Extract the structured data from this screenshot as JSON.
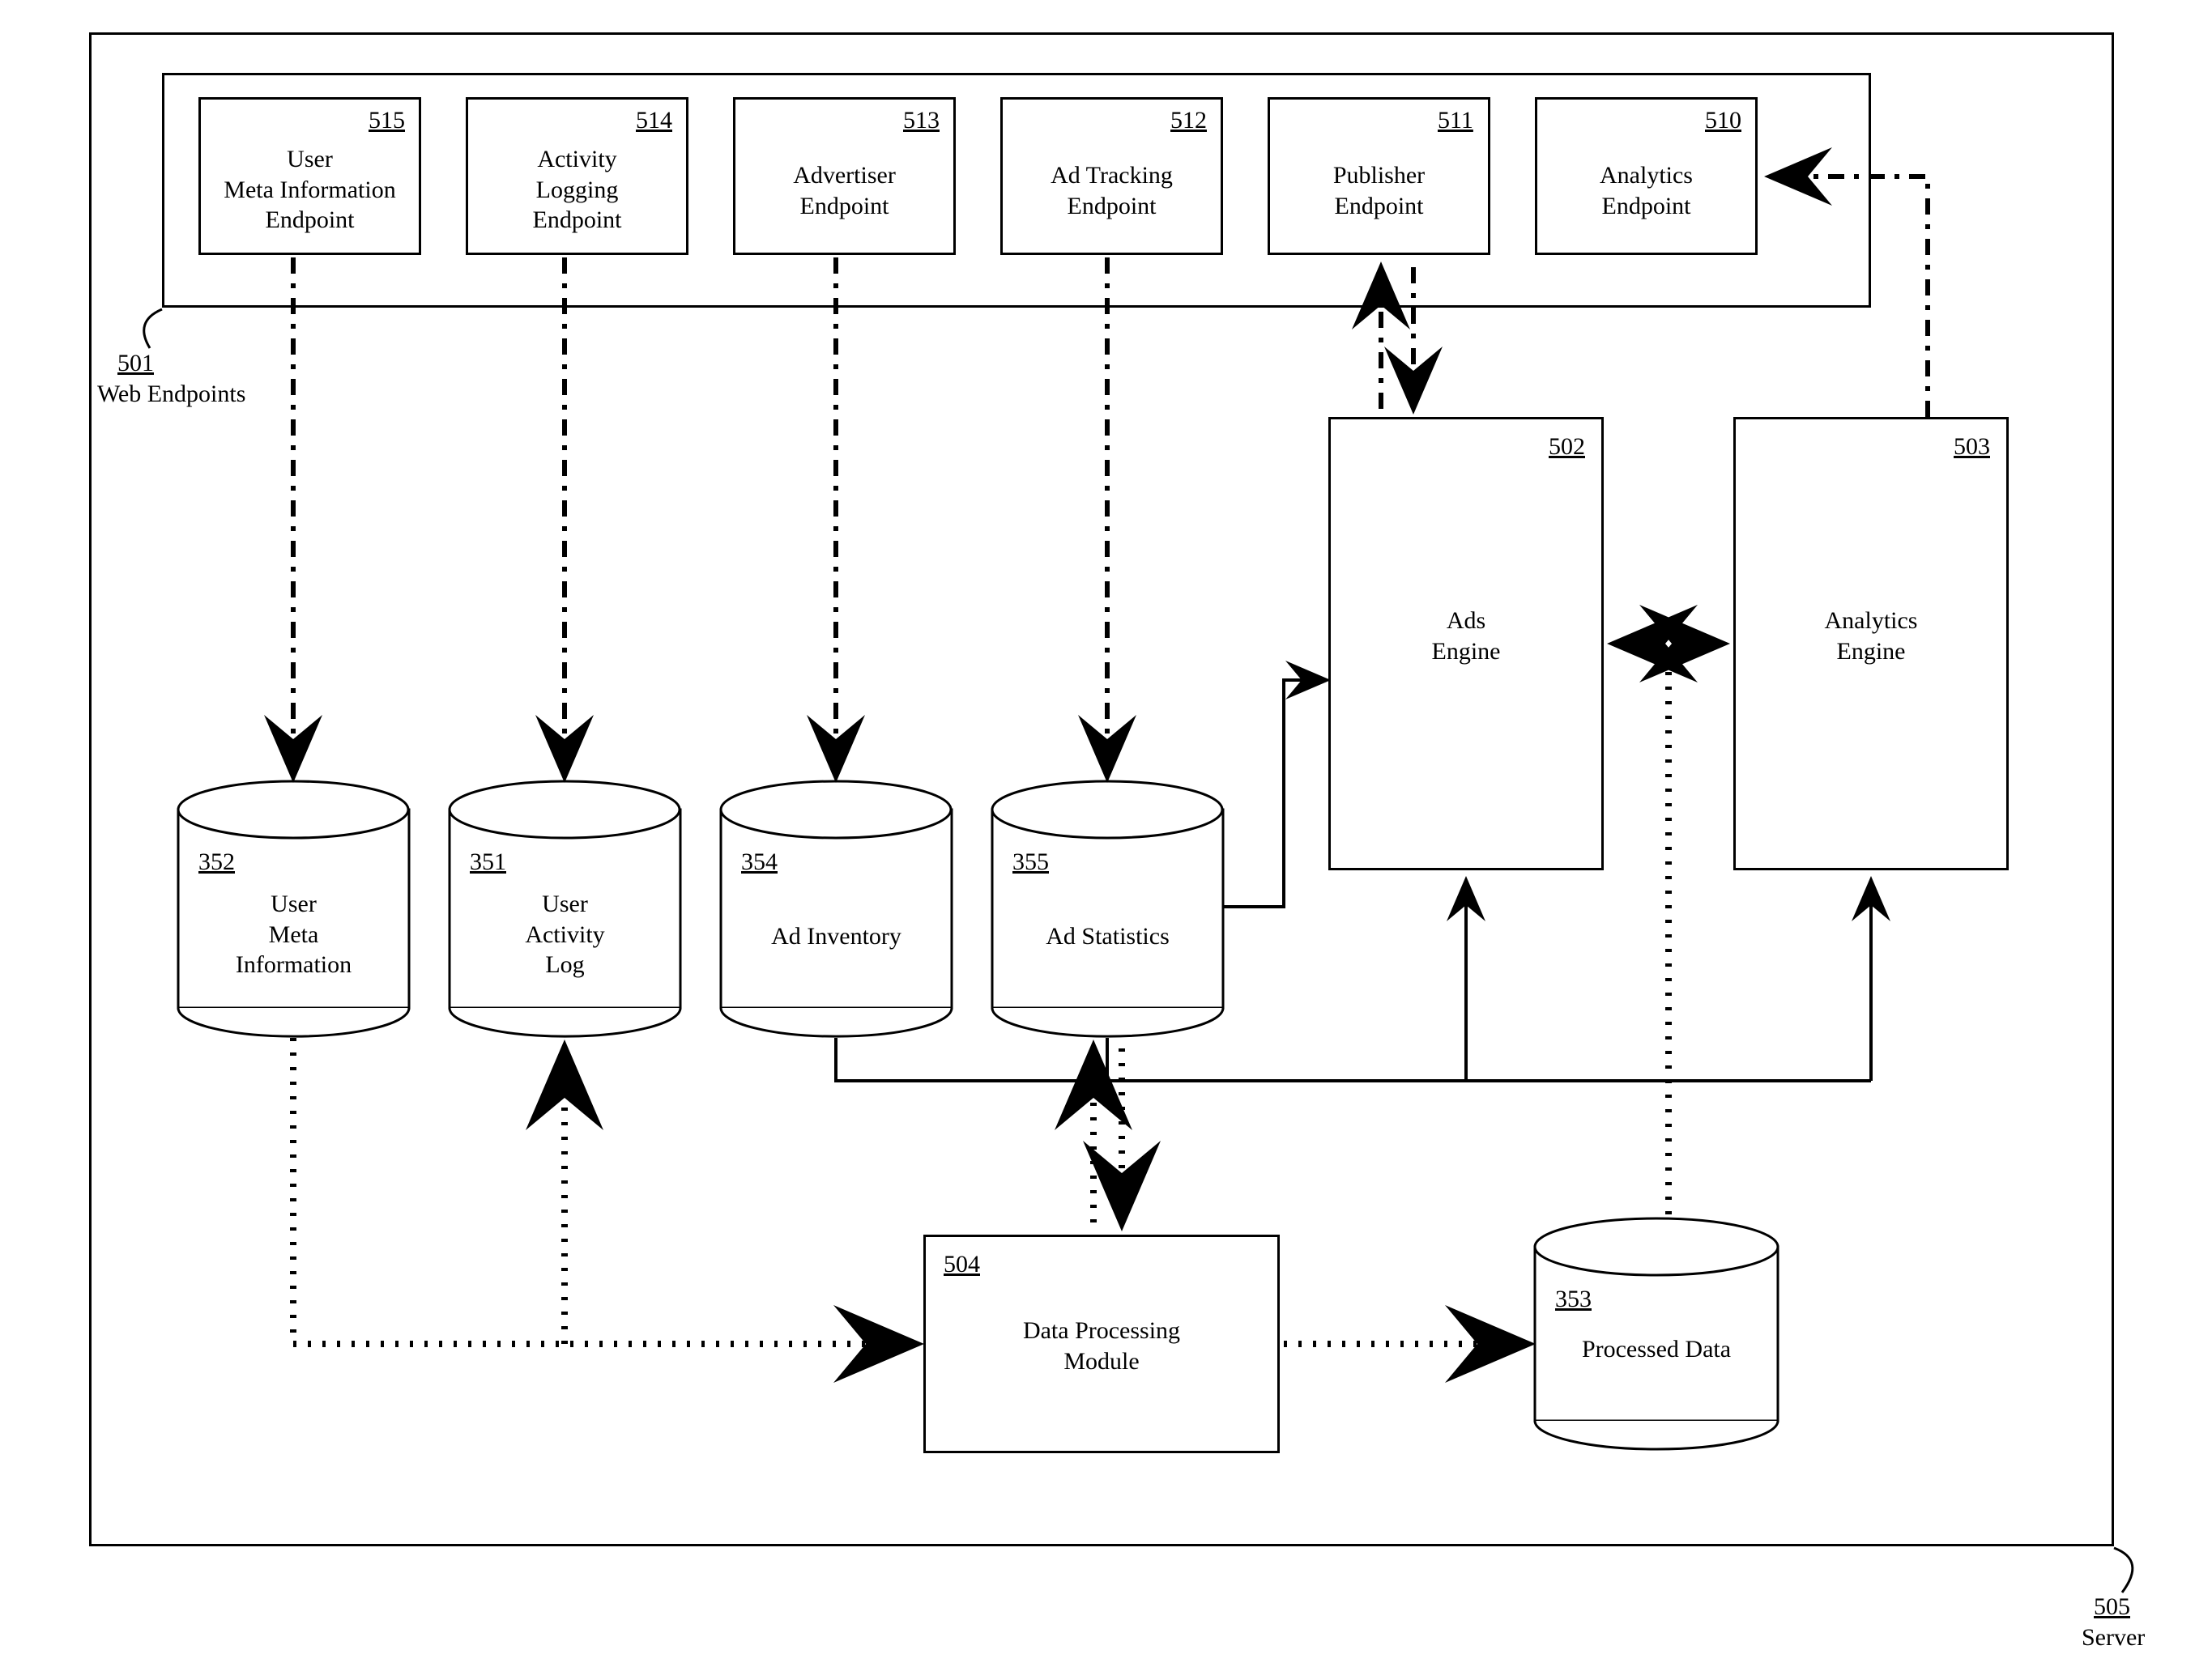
{
  "outer": {
    "callout_ref": "505",
    "callout_label": "Server"
  },
  "endpoints_container": {
    "callout_ref": "501",
    "callout_label": "Web Endpoints"
  },
  "endpoints": {
    "e510": {
      "ref": "510",
      "label": "Analytics\nEndpoint"
    },
    "e511": {
      "ref": "511",
      "label": "Publisher\nEndpoint"
    },
    "e512": {
      "ref": "512",
      "label": "Ad Tracking\nEndpoint"
    },
    "e513": {
      "ref": "513",
      "label": "Advertiser\nEndpoint"
    },
    "e514": {
      "ref": "514",
      "label": "Activity\nLogging\nEndpoint"
    },
    "e515": {
      "ref": "515",
      "label": "User\nMeta Information\nEndpoint"
    }
  },
  "engines": {
    "ads": {
      "ref": "502",
      "label": "Ads\nEngine"
    },
    "analytics": {
      "ref": "503",
      "label": "Analytics\nEngine"
    }
  },
  "dpm": {
    "ref": "504",
    "label": "Data Processing\nModule"
  },
  "cylinders": {
    "c352": {
      "ref": "352",
      "label": "User\nMeta\nInformation"
    },
    "c351": {
      "ref": "351",
      "label": "User\nActivity\nLog"
    },
    "c354": {
      "ref": "354",
      "label": "Ad Inventory"
    },
    "c355": {
      "ref": "355",
      "label": "Ad Statistics"
    },
    "c353": {
      "ref": "353",
      "label": "Processed Data"
    }
  }
}
